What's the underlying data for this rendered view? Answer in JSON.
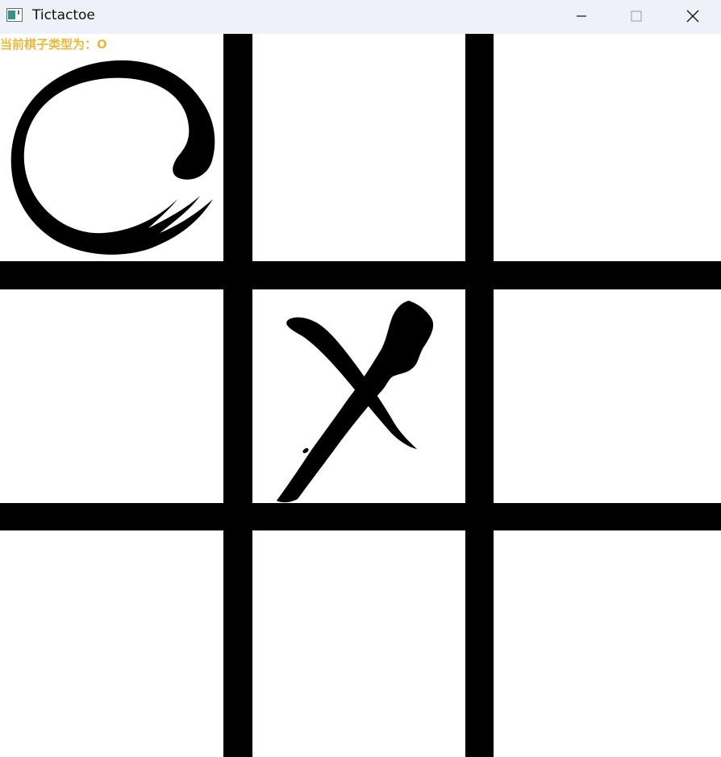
{
  "window": {
    "title": "Tictactoe",
    "controls": {
      "minimize_icon": "minimize-icon",
      "maximize_icon": "maximize-icon",
      "close_icon": "close-icon"
    }
  },
  "game": {
    "status_text": "当前棋子类型为：O",
    "board": [
      [
        "O",
        "",
        ""
      ],
      [
        "",
        "X",
        ""
      ],
      [
        "",
        "",
        ""
      ]
    ],
    "colors": {
      "status": "#e9b93a",
      "grid": "#000000",
      "background": "#ffffff"
    }
  }
}
